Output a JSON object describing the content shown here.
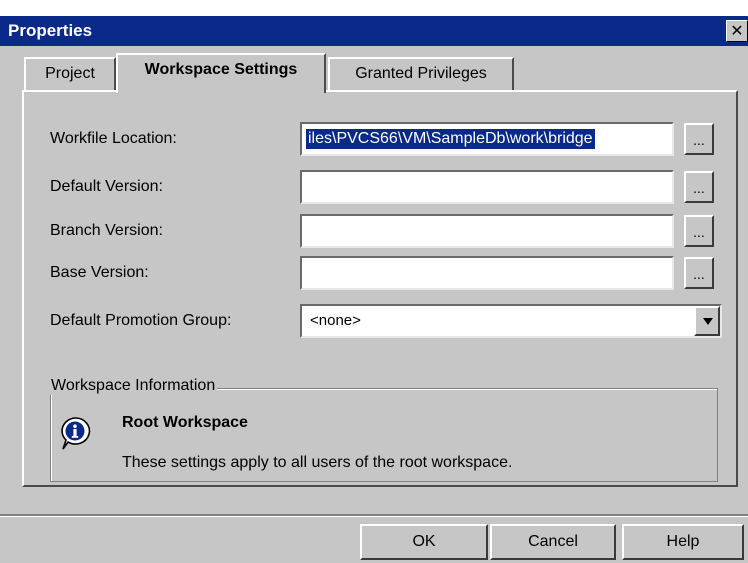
{
  "window": {
    "title": "Properties",
    "close_glyph": "✕"
  },
  "tabs": [
    {
      "label": "Project",
      "active": false
    },
    {
      "label": "Workspace Settings",
      "active": true
    },
    {
      "label": "Granted Privileges",
      "active": false
    }
  ],
  "form": {
    "workfile_location_label": "Workfile Location:",
    "workfile_location_value": "iles\\PVCS66\\VM\\SampleDb\\work\\bridge",
    "default_version_label": "Default Version:",
    "default_version_value": "",
    "branch_version_label": "Branch Version:",
    "branch_version_value": "",
    "base_version_label": "Base Version:",
    "base_version_value": "",
    "promotion_group_label": "Default Promotion Group:",
    "promotion_group_value": "<none>",
    "browse_label": "..."
  },
  "workspace_info": {
    "legend": "Workspace Information",
    "heading": "Root Workspace",
    "description": "These settings apply to all users of the root workspace.",
    "icon": "info-icon"
  },
  "buttons": {
    "ok": "OK",
    "cancel": "Cancel",
    "help": "Help"
  },
  "colors": {
    "titlebar": "#0a2a8a",
    "face": "#c6c6c6",
    "selection": "#0a2a8a"
  }
}
